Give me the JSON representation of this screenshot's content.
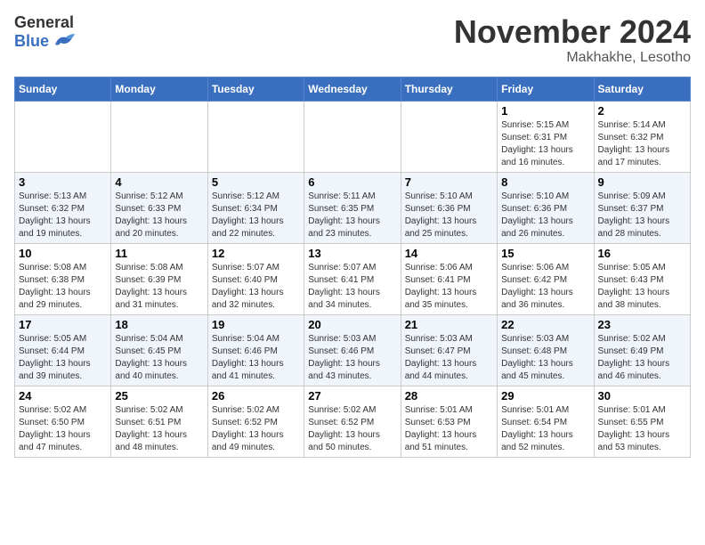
{
  "header": {
    "logo_line1": "General",
    "logo_line2": "Blue",
    "month_title": "November 2024",
    "location": "Makhakhe, Lesotho"
  },
  "weekdays": [
    "Sunday",
    "Monday",
    "Tuesday",
    "Wednesday",
    "Thursday",
    "Friday",
    "Saturday"
  ],
  "weeks": [
    [
      {
        "day": "",
        "info": ""
      },
      {
        "day": "",
        "info": ""
      },
      {
        "day": "",
        "info": ""
      },
      {
        "day": "",
        "info": ""
      },
      {
        "day": "",
        "info": ""
      },
      {
        "day": "1",
        "info": "Sunrise: 5:15 AM\nSunset: 6:31 PM\nDaylight: 13 hours\nand 16 minutes."
      },
      {
        "day": "2",
        "info": "Sunrise: 5:14 AM\nSunset: 6:32 PM\nDaylight: 13 hours\nand 17 minutes."
      }
    ],
    [
      {
        "day": "3",
        "info": "Sunrise: 5:13 AM\nSunset: 6:32 PM\nDaylight: 13 hours\nand 19 minutes."
      },
      {
        "day": "4",
        "info": "Sunrise: 5:12 AM\nSunset: 6:33 PM\nDaylight: 13 hours\nand 20 minutes."
      },
      {
        "day": "5",
        "info": "Sunrise: 5:12 AM\nSunset: 6:34 PM\nDaylight: 13 hours\nand 22 minutes."
      },
      {
        "day": "6",
        "info": "Sunrise: 5:11 AM\nSunset: 6:35 PM\nDaylight: 13 hours\nand 23 minutes."
      },
      {
        "day": "7",
        "info": "Sunrise: 5:10 AM\nSunset: 6:36 PM\nDaylight: 13 hours\nand 25 minutes."
      },
      {
        "day": "8",
        "info": "Sunrise: 5:10 AM\nSunset: 6:36 PM\nDaylight: 13 hours\nand 26 minutes."
      },
      {
        "day": "9",
        "info": "Sunrise: 5:09 AM\nSunset: 6:37 PM\nDaylight: 13 hours\nand 28 minutes."
      }
    ],
    [
      {
        "day": "10",
        "info": "Sunrise: 5:08 AM\nSunset: 6:38 PM\nDaylight: 13 hours\nand 29 minutes."
      },
      {
        "day": "11",
        "info": "Sunrise: 5:08 AM\nSunset: 6:39 PM\nDaylight: 13 hours\nand 31 minutes."
      },
      {
        "day": "12",
        "info": "Sunrise: 5:07 AM\nSunset: 6:40 PM\nDaylight: 13 hours\nand 32 minutes."
      },
      {
        "day": "13",
        "info": "Sunrise: 5:07 AM\nSunset: 6:41 PM\nDaylight: 13 hours\nand 34 minutes."
      },
      {
        "day": "14",
        "info": "Sunrise: 5:06 AM\nSunset: 6:41 PM\nDaylight: 13 hours\nand 35 minutes."
      },
      {
        "day": "15",
        "info": "Sunrise: 5:06 AM\nSunset: 6:42 PM\nDaylight: 13 hours\nand 36 minutes."
      },
      {
        "day": "16",
        "info": "Sunrise: 5:05 AM\nSunset: 6:43 PM\nDaylight: 13 hours\nand 38 minutes."
      }
    ],
    [
      {
        "day": "17",
        "info": "Sunrise: 5:05 AM\nSunset: 6:44 PM\nDaylight: 13 hours\nand 39 minutes."
      },
      {
        "day": "18",
        "info": "Sunrise: 5:04 AM\nSunset: 6:45 PM\nDaylight: 13 hours\nand 40 minutes."
      },
      {
        "day": "19",
        "info": "Sunrise: 5:04 AM\nSunset: 6:46 PM\nDaylight: 13 hours\nand 41 minutes."
      },
      {
        "day": "20",
        "info": "Sunrise: 5:03 AM\nSunset: 6:46 PM\nDaylight: 13 hours\nand 43 minutes."
      },
      {
        "day": "21",
        "info": "Sunrise: 5:03 AM\nSunset: 6:47 PM\nDaylight: 13 hours\nand 44 minutes."
      },
      {
        "day": "22",
        "info": "Sunrise: 5:03 AM\nSunset: 6:48 PM\nDaylight: 13 hours\nand 45 minutes."
      },
      {
        "day": "23",
        "info": "Sunrise: 5:02 AM\nSunset: 6:49 PM\nDaylight: 13 hours\nand 46 minutes."
      }
    ],
    [
      {
        "day": "24",
        "info": "Sunrise: 5:02 AM\nSunset: 6:50 PM\nDaylight: 13 hours\nand 47 minutes."
      },
      {
        "day": "25",
        "info": "Sunrise: 5:02 AM\nSunset: 6:51 PM\nDaylight: 13 hours\nand 48 minutes."
      },
      {
        "day": "26",
        "info": "Sunrise: 5:02 AM\nSunset: 6:52 PM\nDaylight: 13 hours\nand 49 minutes."
      },
      {
        "day": "27",
        "info": "Sunrise: 5:02 AM\nSunset: 6:52 PM\nDaylight: 13 hours\nand 50 minutes."
      },
      {
        "day": "28",
        "info": "Sunrise: 5:01 AM\nSunset: 6:53 PM\nDaylight: 13 hours\nand 51 minutes."
      },
      {
        "day": "29",
        "info": "Sunrise: 5:01 AM\nSunset: 6:54 PM\nDaylight: 13 hours\nand 52 minutes."
      },
      {
        "day": "30",
        "info": "Sunrise: 5:01 AM\nSunset: 6:55 PM\nDaylight: 13 hours\nand 53 minutes."
      }
    ]
  ]
}
